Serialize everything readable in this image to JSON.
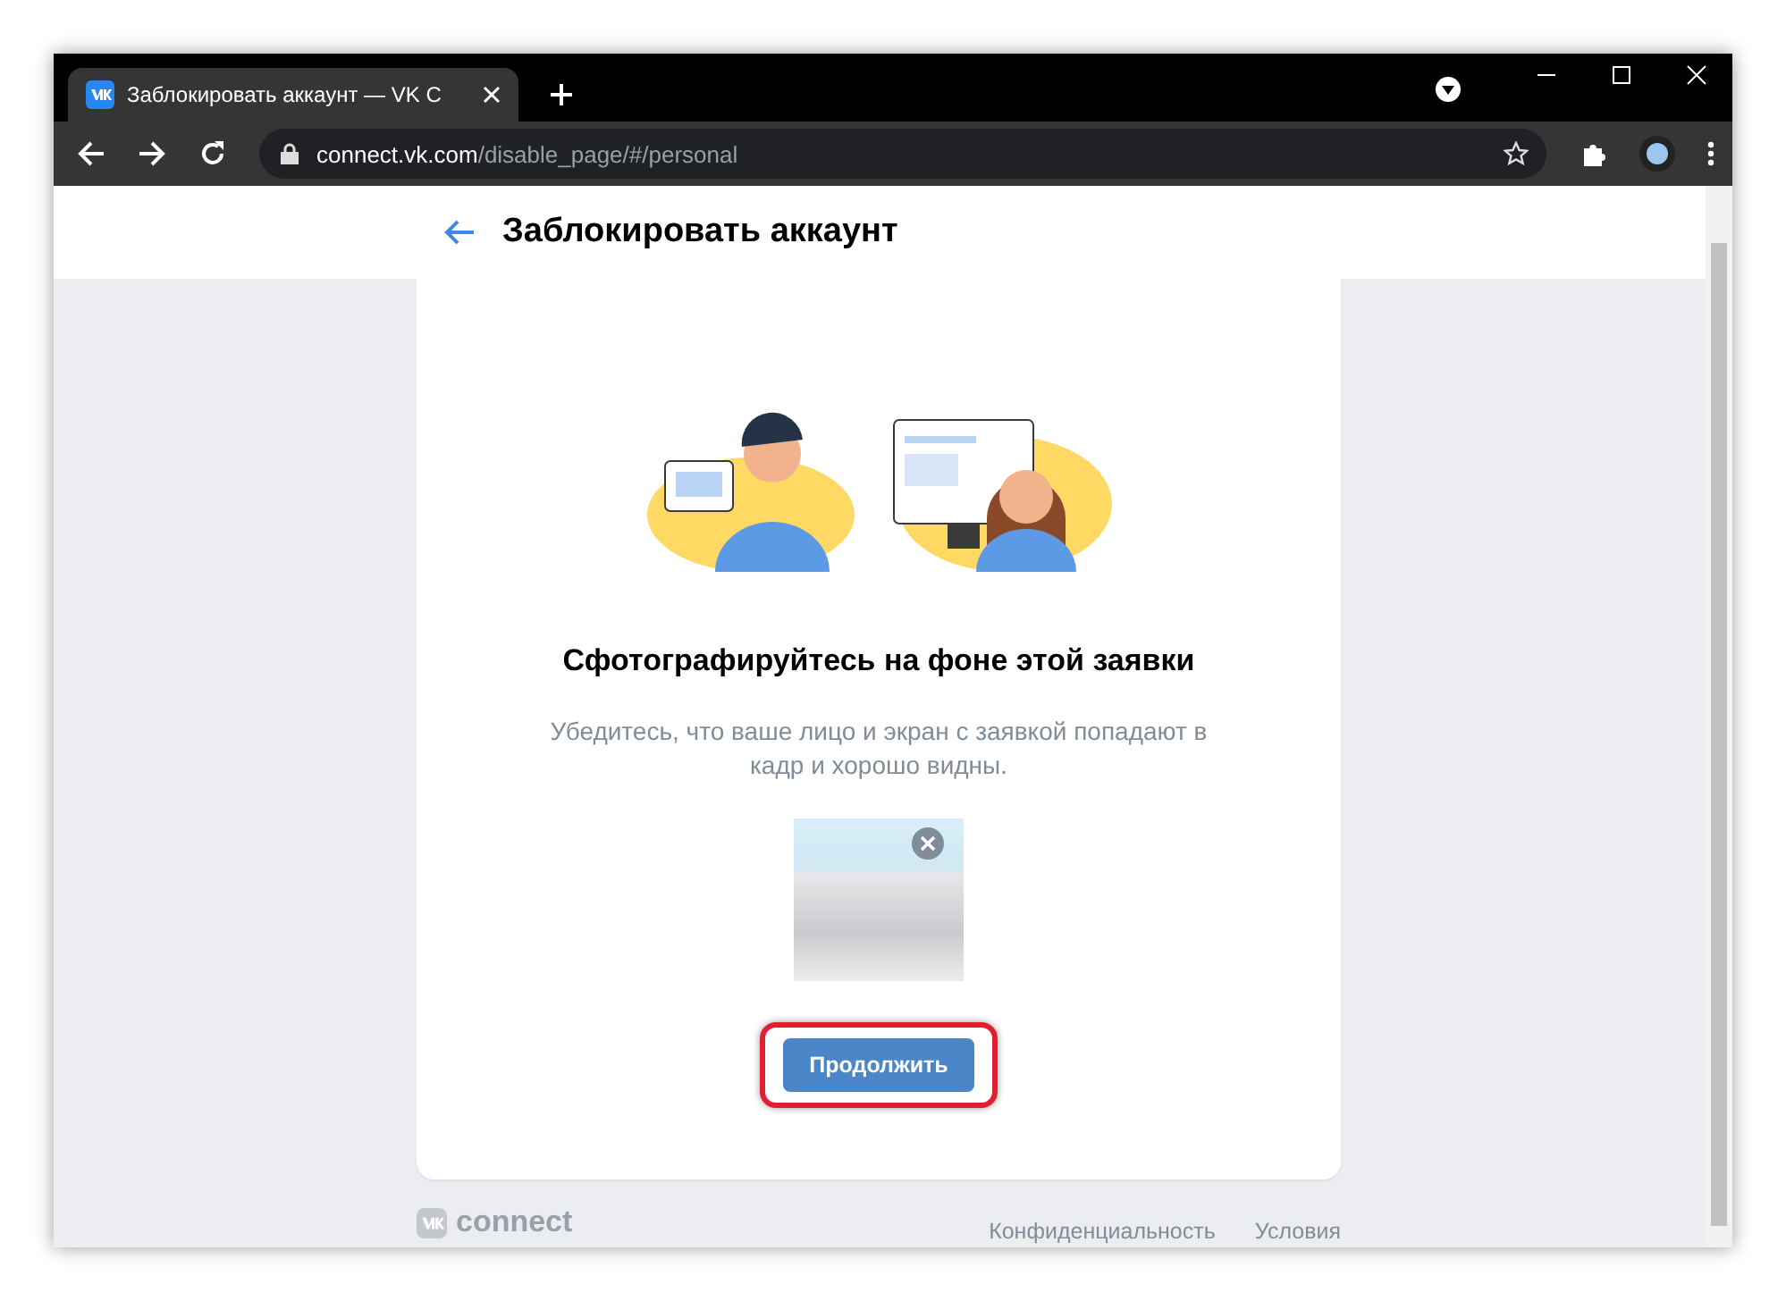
{
  "browser": {
    "tabs": [
      {
        "title": "Заблокировать аккаунт — VK C",
        "selected": true
      }
    ],
    "address": {
      "host": "connect.vk.com",
      "path": "/disable_page/#/personal"
    }
  },
  "page": {
    "title": "Заблокировать аккаунт",
    "heading": "Сфотографируйтесь на фоне этой заявки",
    "hint": "Убедитесь, что ваше лицо и экран с заявкой попадают в кадр и хорошо видны.",
    "button": "Продолжить",
    "button_highlighted": true
  },
  "footer": {
    "logo": "connect",
    "links": [
      "Конфиденциальность",
      "Условия"
    ]
  }
}
